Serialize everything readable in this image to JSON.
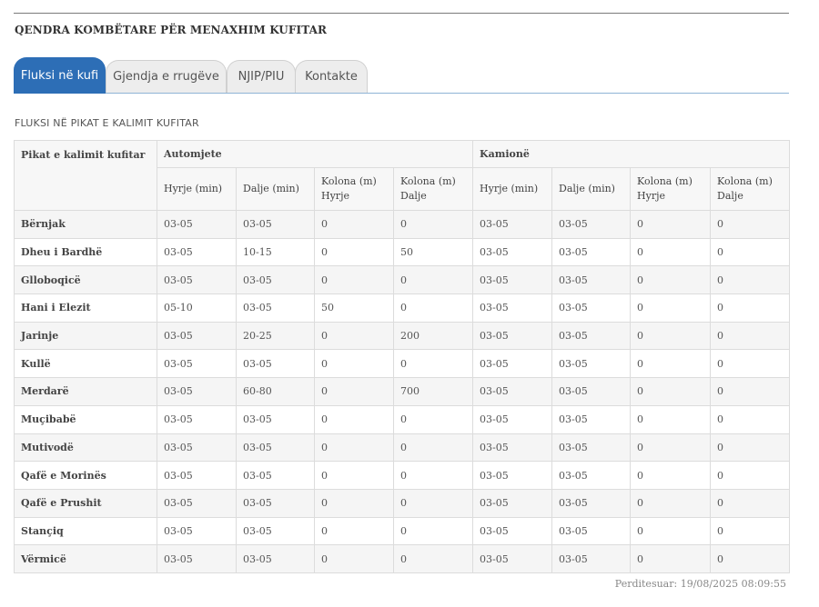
{
  "header": {
    "title": "QENDRA KOMBËTARE PËR MENAXHIM KUFITAR"
  },
  "tabs": [
    {
      "label": "Fluksi në kufi",
      "active": true
    },
    {
      "label": "Gjendja e rrugëve",
      "active": false
    },
    {
      "label": "NJIP/PIU",
      "active": false
    },
    {
      "label": "Kontakte",
      "active": false
    }
  ],
  "section": {
    "title": "FLUKSI NË PIKAT E KALIMIT KUFITAR"
  },
  "table": {
    "point_header": "Pikat e kalimit kufitar",
    "groups": [
      "Automjete",
      "Kamionë"
    ],
    "subheaders": [
      "Hyrje (min)",
      "Dalje (min)",
      "Kolona (m) Hyrje",
      "Kolona (m) Dalje",
      "Hyrje (min)",
      "Dalje (min)",
      "Kolona (m) Hyrje",
      "Kolona (m) Dalje"
    ],
    "rows": [
      [
        "Bërnjak",
        "03-05",
        "03-05",
        "0",
        "0",
        "03-05",
        "03-05",
        "0",
        "0"
      ],
      [
        "Dheu i Bardhë",
        "03-05",
        "10-15",
        "0",
        "50",
        "03-05",
        "03-05",
        "0",
        "0"
      ],
      [
        "Glloboqicë",
        "03-05",
        "03-05",
        "0",
        "0",
        "03-05",
        "03-05",
        "0",
        "0"
      ],
      [
        "Hani i Elezit",
        "05-10",
        "03-05",
        "50",
        "0",
        "03-05",
        "03-05",
        "0",
        "0"
      ],
      [
        "Jarinje",
        "03-05",
        "20-25",
        "0",
        "200",
        "03-05",
        "03-05",
        "0",
        "0"
      ],
      [
        "Kullë",
        "03-05",
        "03-05",
        "0",
        "0",
        "03-05",
        "03-05",
        "0",
        "0"
      ],
      [
        "Merdarë",
        "03-05",
        "60-80",
        "0",
        "700",
        "03-05",
        "03-05",
        "0",
        "0"
      ],
      [
        "Muçibabë",
        "03-05",
        "03-05",
        "0",
        "0",
        "03-05",
        "03-05",
        "0",
        "0"
      ],
      [
        "Mutivodë",
        "03-05",
        "03-05",
        "0",
        "0",
        "03-05",
        "03-05",
        "0",
        "0"
      ],
      [
        "Qafë e Morinës",
        "03-05",
        "03-05",
        "0",
        "0",
        "03-05",
        "03-05",
        "0",
        "0"
      ],
      [
        "Qafë e Prushit",
        "03-05",
        "03-05",
        "0",
        "0",
        "03-05",
        "03-05",
        "0",
        "0"
      ],
      [
        "Stançiq",
        "03-05",
        "03-05",
        "0",
        "0",
        "03-05",
        "03-05",
        "0",
        "0"
      ],
      [
        "Vërmicë",
        "03-05",
        "03-05",
        "0",
        "0",
        "03-05",
        "03-05",
        "0",
        "0"
      ]
    ]
  },
  "footer": {
    "updated": "Perditesuar: 19/08/2025 08:09:55"
  },
  "colors": {
    "accent": "#2d6eb6",
    "tab_inactive": "#ededed",
    "row_alt": "#f5f5f5"
  }
}
